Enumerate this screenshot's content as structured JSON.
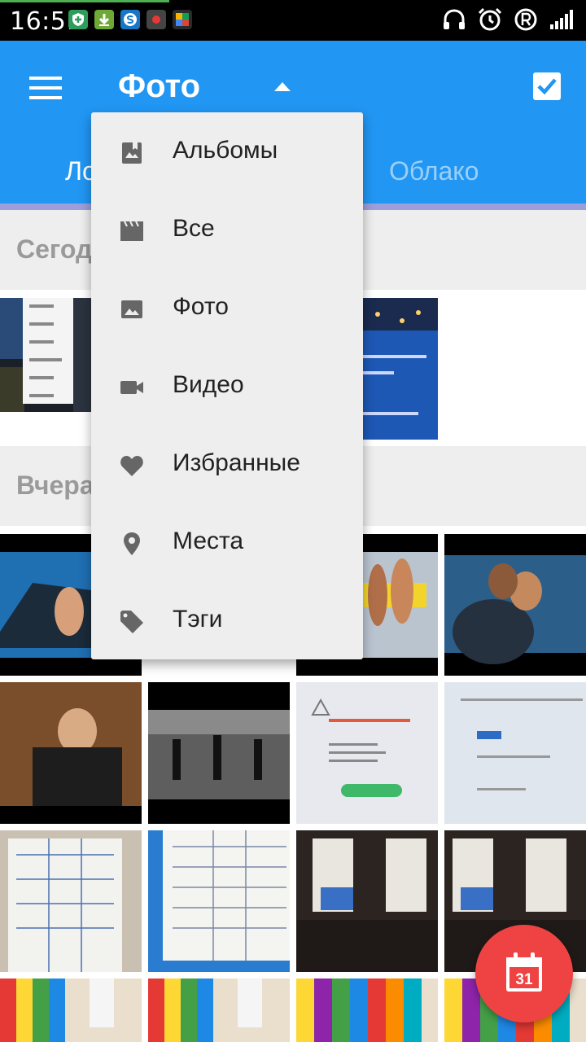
{
  "status_bar": {
    "time": "16:51"
  },
  "appbar": {
    "title": "Фото",
    "tabs": [
      {
        "label": "Ло"
      },
      {
        "label": "Облако"
      }
    ]
  },
  "sections": [
    {
      "label": "Сегод"
    },
    {
      "label": "Вчера"
    }
  ],
  "dropdown": {
    "items": [
      {
        "label": "Альбомы",
        "icon": "album-icon"
      },
      {
        "label": "Все",
        "icon": "clapper-icon"
      },
      {
        "label": "Фото",
        "icon": "image-icon"
      },
      {
        "label": "Видео",
        "icon": "videocam-icon"
      },
      {
        "label": "Избранные",
        "icon": "heart-icon"
      },
      {
        "label": "Места",
        "icon": "place-icon"
      },
      {
        "label": "Тэги",
        "icon": "tag-icon"
      }
    ]
  },
  "fab": {
    "date": "31"
  },
  "colors": {
    "primary": "#2196f3",
    "fab": "#ef4343",
    "section_bg": "#eeeeee",
    "menu_bg": "#eeeeee"
  }
}
